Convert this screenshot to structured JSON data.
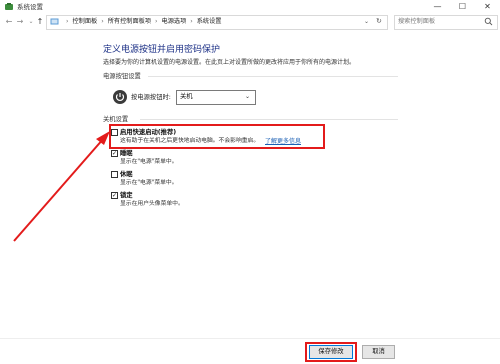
{
  "window": {
    "title": "系统设置",
    "minimize": "—",
    "maximize": "☐",
    "close": "✕"
  },
  "nav": {
    "back": "←",
    "forward": "→",
    "dropdown": "⌄",
    "up": "↑",
    "refresh": "↻",
    "crumb_chevron": "›",
    "breadcrumbs": [
      "控制面板",
      "所有控制面板项",
      "电源选项",
      "系统设置"
    ],
    "search_placeholder": "搜索控制面板"
  },
  "main": {
    "title": "定义电源按钮并启用密码保护",
    "description": "选择要为你的计算机设置的电源设置。在此页上对设置所做的更改将应用于你所有的电源计划。",
    "power_section_title": "电源按钮设置",
    "power_button_label": "按电源按钮时:",
    "power_button_value": "关机",
    "shutdown_section_title": "关机设置",
    "options": [
      {
        "label": "启用快速启动(推荐)",
        "desc": "这有助于在关机之后更快地启动电脑。不会影响重启。",
        "checked": false,
        "link": "了解更多信息"
      },
      {
        "label": "睡眠",
        "desc": "显示在\"电源\"菜单中。",
        "checked": true
      },
      {
        "label": "休眠",
        "desc": "显示在\"电源\"菜单中。",
        "checked": false
      },
      {
        "label": "锁定",
        "desc": "显示在用户头像菜单中。",
        "checked": true
      }
    ]
  },
  "footer": {
    "save_label": "保存修改",
    "cancel_label": "取消"
  },
  "colors": {
    "annotation_red": "#e31b1b",
    "title_blue": "#1e3287",
    "link_blue": "#1a5fb4"
  }
}
